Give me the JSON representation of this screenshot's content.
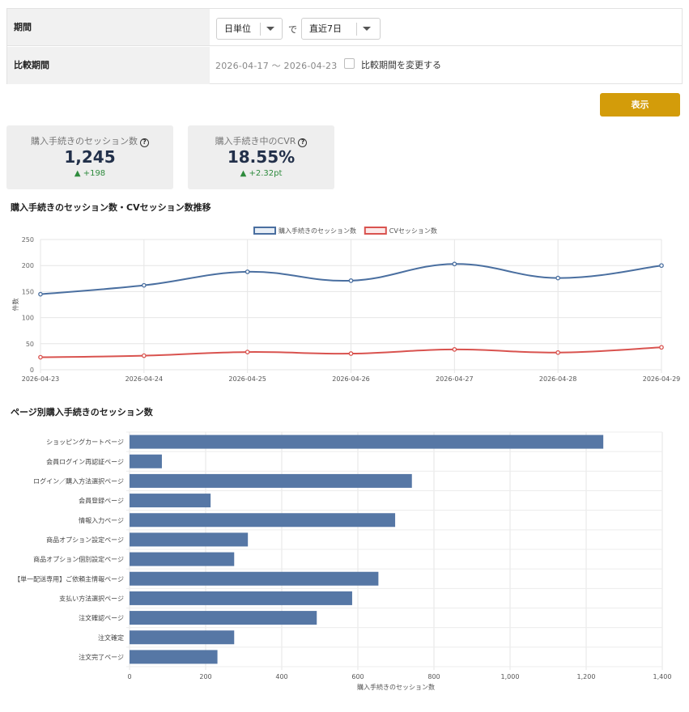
{
  "filters": {
    "period_label": "期間",
    "unit_select": "日単位",
    "de": "で",
    "range_select": "直近7日",
    "compare_label": "比較期間",
    "compare_range": "2026-04-17 ～ 2026-04-23",
    "compare_checkbox_label": "比較期間を変更する"
  },
  "show_button": "表示",
  "kpis": [
    {
      "title": "購入手続きのセッション数",
      "value": "1,245",
      "diff": "▲ +198"
    },
    {
      "title": "購入手続き中のCVR",
      "value": "18.55%",
      "diff": "▲ +2.32pt"
    }
  ],
  "line_section_title": "購入手続きのセッション数・CVセッション数推移",
  "bar_section_title": "ページ別購入手続きのセッション数",
  "chart_data": [
    {
      "type": "line",
      "x": [
        "2026-04-23",
        "2026-04-24",
        "2026-04-25",
        "2026-04-26",
        "2026-04-27",
        "2026-04-28",
        "2026-04-29"
      ],
      "series": [
        {
          "name": "購入手続きのセッション数",
          "values": [
            145,
            162,
            188,
            171,
            203,
            176,
            200
          ],
          "color": "#4a6fa0"
        },
        {
          "name": "CVセッション数",
          "values": [
            24,
            27,
            34,
            31,
            39,
            33,
            43
          ],
          "color": "#d9534f"
        }
      ],
      "ylabel": "件数",
      "ylim": [
        0,
        250
      ],
      "yticks": [
        0,
        50,
        100,
        150,
        200,
        250
      ],
      "grid": true,
      "legend": "top-center"
    },
    {
      "type": "bar",
      "orientation": "horizontal",
      "categories": [
        "ショッピングカートページ",
        "会員ログイン再認証ページ",
        "ログイン／購入方法選択ページ",
        "会員登録ページ",
        "情報入力ページ",
        "商品オプション設定ページ",
        "商品オプション個別設定ページ",
        "【単一配送専用】ご依頼主情報ページ",
        "支払い方法選択ページ",
        "注文確認ページ",
        "注文確定",
        "注文完了ページ"
      ],
      "values": [
        1245,
        85,
        742,
        213,
        698,
        311,
        275,
        654,
        585,
        492,
        275,
        231
      ],
      "xlabel": "購入手続きのセッション数",
      "xlim": [
        0,
        1400
      ],
      "xticks": [
        0,
        200,
        400,
        600,
        800,
        1000,
        1200,
        1400
      ],
      "xtick_labels": [
        "0",
        "200",
        "400",
        "600",
        "800",
        "1,000",
        "1,200",
        "1,400"
      ],
      "color": "#5677a5",
      "grid": true
    }
  ]
}
